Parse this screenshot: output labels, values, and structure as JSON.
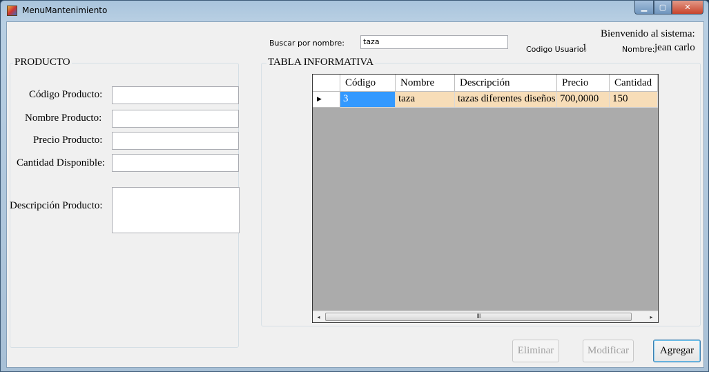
{
  "window": {
    "title": "MenuMantenimiento"
  },
  "search": {
    "label": "Buscar por nombre:",
    "value": "taza"
  },
  "header": {
    "welcome": "Bienvenido al sistema:",
    "user_code_label": "Codigo Usuario:",
    "user_code_value": "1",
    "name_label": "Nombre:",
    "name_value": "jean carlo"
  },
  "producto": {
    "title": "PRODUCTO",
    "fields": [
      {
        "label": "Código Producto:",
        "value": ""
      },
      {
        "label": "Nombre Producto:",
        "value": ""
      },
      {
        "label": "Precio Producto:",
        "value": ""
      },
      {
        "label": "Cantidad Disponible:",
        "value": ""
      },
      {
        "label": "Descripción Producto:",
        "value": ""
      }
    ]
  },
  "tabla": {
    "title": "TABLA INFORMATIVA",
    "columns": [
      "Código",
      "Nombre",
      "Descripción",
      "Precio",
      "Cantidad"
    ],
    "rows": [
      [
        "3",
        "taza",
        "tazas diferentes diseños",
        "700,0000",
        "150"
      ]
    ],
    "scroll_grip": "III"
  },
  "buttons": {
    "eliminar": "Eliminar",
    "modificar": "Modificar",
    "agregar": "Agregar"
  },
  "colors": {
    "selected_row": "#f7ddb8",
    "selected_cell": "#3399ff",
    "grid_background": "#ababab"
  }
}
